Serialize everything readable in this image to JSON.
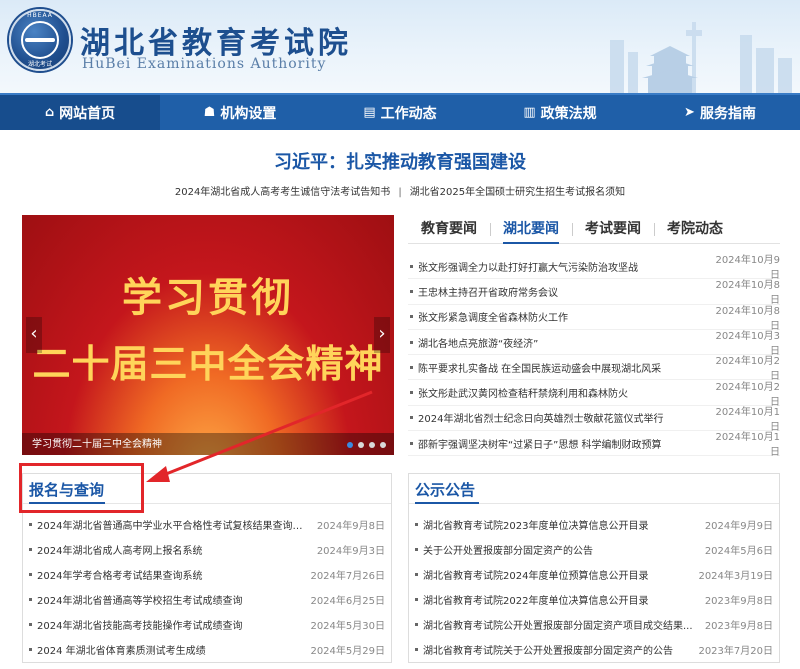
{
  "header": {
    "emblem_top": "HBEAA",
    "emblem_bottom": "湖北考试",
    "title_cn": "湖北省教育考试院",
    "title_en": "HuBei Examinations Authority"
  },
  "nav": [
    {
      "label": "网站首页",
      "icon": "⌂"
    },
    {
      "label": "机构设置",
      "icon": "☗"
    },
    {
      "label": "工作动态",
      "icon": "▤"
    },
    {
      "label": "政策法规",
      "icon": "▥"
    },
    {
      "label": "服务指南",
      "icon": "➤"
    }
  ],
  "headline": "习近平：扎实推动教育强国建设",
  "subnews": [
    "2024年湖北省成人高考考生诚信守法考试告知书",
    "|",
    "湖北省2025年全国硕士研究生招生考试报名须知"
  ],
  "carousel": {
    "line1": "学习贯彻",
    "line2": "二十届三中全会精神",
    "caption": "学习贯彻二十届三中全会精神",
    "prev": "‹",
    "next": "›"
  },
  "news_tabs": [
    "教育要闻",
    "湖北要闻",
    "考试要闻",
    "考院动态"
  ],
  "news": [
    {
      "title": "张文彤强调全力以赴打好打赢大气污染防治攻坚战",
      "date": "2024年10月9日"
    },
    {
      "title": "王忠林主持召开省政府常务会议",
      "date": "2024年10月8日"
    },
    {
      "title": "张文彤紧急调度全省森林防火工作",
      "date": "2024年10月8日"
    },
    {
      "title": "湖北各地点亮旅游“夜经济”",
      "date": "2024年10月3日"
    },
    {
      "title": "陈平要求扎实备战 在全国民族运动盛会中展现湖北风采",
      "date": "2024年10月2日"
    },
    {
      "title": "张文彤赴武汉黄冈检查秸秆禁烧利用和森林防火",
      "date": "2024年10月2日"
    },
    {
      "title": "2024年湖北省烈士纪念日向英雄烈士敬献花篮仪式举行",
      "date": "2024年10月1日"
    },
    {
      "title": "邵新宇强调坚决树牢“过紧日子”思想 科学编制财政预算",
      "date": "2024年10月1日"
    }
  ],
  "left_box": {
    "title": "报名与查询",
    "items": [
      {
        "title": "2024年湖北省普通高中学业水平合格性考试复核结果查询系统",
        "date": "2024年9月8日"
      },
      {
        "title": "2024年湖北省成人高考网上报名系统",
        "date": "2024年9月3日"
      },
      {
        "title": "2024年学考合格考考试结果查询系统",
        "date": "2024年7月26日"
      },
      {
        "title": "2024年湖北省普通高等学校招生考试成绩查询",
        "date": "2024年6月25日"
      },
      {
        "title": "2024年湖北省技能高考技能操作考试成绩查询",
        "date": "2024年5月30日"
      },
      {
        "title": "2024 年湖北省体育素质测试考生成绩",
        "date": "2024年5月29日"
      }
    ]
  },
  "right_box": {
    "title": "公示公告",
    "items": [
      {
        "title": "湖北省教育考试院2023年度单位决算信息公开目录",
        "date": "2024年9月9日"
      },
      {
        "title": "关于公开处置报废部分固定资产的公告",
        "date": "2024年5月6日"
      },
      {
        "title": "湖北省教育考试院2024年度单位预算信息公开目录",
        "date": "2024年3月19日"
      },
      {
        "title": "湖北省教育考试院2022年度单位决算信息公开目录",
        "date": "2023年9月8日"
      },
      {
        "title": "湖北省教育考试院公开处置报废部分固定资产项目成交结果...",
        "date": "2023年9月8日"
      },
      {
        "title": "湖北省教育考试院关于公开处置报废部分固定资产的公告",
        "date": "2023年7月20日"
      }
    ]
  },
  "colors": {
    "brand": "#1f5fa8",
    "accent": "#1b57a6",
    "highlight": "#e2262a"
  }
}
